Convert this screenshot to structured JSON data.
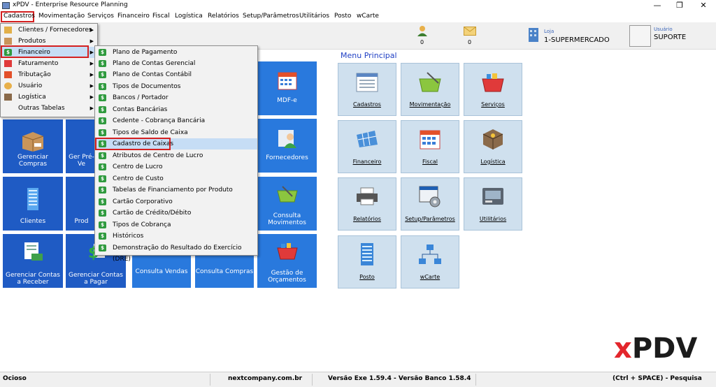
{
  "window": {
    "title": "xPDV - Enterprise Resource Planning",
    "minimize": "—",
    "restore": "❐",
    "close": "✕"
  },
  "menubar": [
    "Cadastros",
    "Movimentação",
    "Serviços",
    "Financeiro",
    "Fiscal",
    "Logística",
    "Relatórios",
    "Setup/Parâmetros",
    "Utilitários",
    "Posto",
    "wCarte"
  ],
  "toolbar": {
    "users_count": "0",
    "messages_count": "0",
    "loja_label": "Loja",
    "loja_value": "1-SUPERMERCADO",
    "usuario_label": "Usuário",
    "usuario_value": "SUPORTE"
  },
  "cadastros_menu": [
    "Clientes / Fornecedores",
    "Produtos",
    "Financeiro",
    "Faturamento",
    "Tributação",
    "Usuário",
    "Logística",
    "Outras Tabelas"
  ],
  "financeiro_menu": [
    "Plano de Pagamento",
    "Plano de Contas Gerencial",
    "Plano de Contas Contábil",
    "Tipos de Documentos",
    "Bancos / Portador",
    "Contas Bancárias",
    "Cedente - Cobrança Bancária",
    "Tipos de Saldo de Caixa",
    "Cadastro de Caixas",
    "Atributos de Centro de Lucro",
    "Centro de Lucro",
    "Centro de Custo",
    "Tabelas de Financiamento por Produto",
    "Cartão Corporativo",
    "Cartão de Crédito/Débito",
    "Tipos de Cobrança",
    "Históricos",
    "Demonstração do Resultado do Exercício (DRE)"
  ],
  "left_tiles": {
    "gerenciar_compras": "Gerenciar Compras",
    "gerenciar_pre_venda_partial": "Ger Pré-Ve",
    "clientes": "Clientes",
    "produtos_partial": "Prod",
    "contas_receber": "Gerenciar Contas a Receber",
    "contas_pagar": "Gerenciar Contas a Pagar",
    "consulta_vendas": "Consulta Vendas",
    "consulta_compras": "Consulta Compras",
    "mdfe": "MDF-e",
    "fornecedores": "Fornecedores",
    "consulta_movimentos": "Consulta Movimentos",
    "gestao_orcamentos": "Gestão de Orçamentos"
  },
  "menu_principal": {
    "title": "Menu Principal",
    "items": [
      "Cadastros",
      "Movimentação",
      "Serviços",
      "Financeiro",
      "Fiscal",
      "Logística",
      "Relatórios",
      "Setup/Parâmetros",
      "Utilitários",
      "Posto",
      "wCarte"
    ]
  },
  "brand": {
    "x": "x",
    "pdv": "PDV"
  },
  "statusbar": {
    "state": "Ocioso",
    "website": "nextcompany.com.br",
    "version": "Versão Exe 1.59.4 - Versão Banco 1.58.4",
    "shortcut": "(Ctrl + SPACE) - Pesquisa"
  },
  "colors": {
    "tile_dark": "#1f5bc4",
    "tile_light": "#2979dd",
    "menu_tile": "#cfe0ee",
    "highlight": "#c6ddf5",
    "brand_red": "#e3262c",
    "accent_blue": "#3a64b8"
  }
}
